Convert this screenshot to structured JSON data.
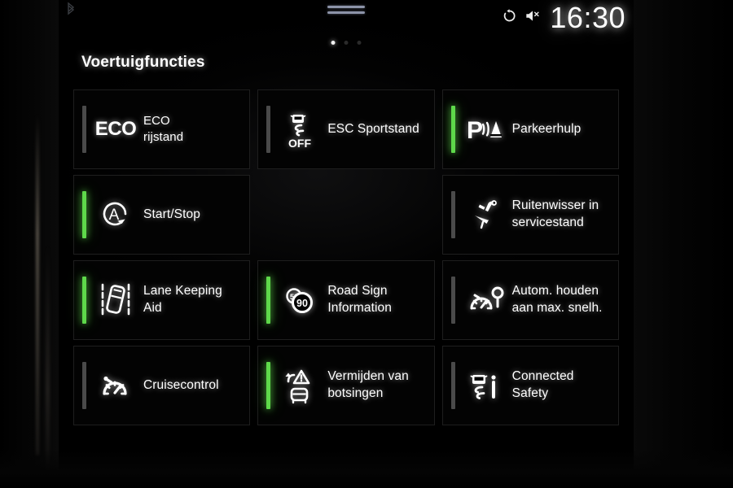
{
  "statusbar": {
    "bluetooth_icon": "bluetooth-icon",
    "drag_handle": "drag-handle",
    "alarm_icon": "alarm-timer-icon",
    "mute_icon": "volume-muted-icon",
    "time": "16:30"
  },
  "page_indicator": {
    "total": 3,
    "current": 1
  },
  "header": {
    "title": "Voertuigfuncties"
  },
  "colors": {
    "accent_active": "#5ed84a",
    "indicator_inactive": "#4a4a4a",
    "text": "#ffffff",
    "tile_border": "#1e1e1e",
    "background": "#000000"
  },
  "tiles": [
    {
      "id": "eco-rijstand",
      "icon": "eco-icon",
      "icon_text": "ECO",
      "label_line1": "ECO",
      "label_line2": "rijstand",
      "active": false
    },
    {
      "id": "esc-sportstand",
      "icon": "esc-off-icon",
      "label_line1": "ESC Sportstand",
      "label_line2": "",
      "active": false
    },
    {
      "id": "parkeerhulp",
      "icon": "park-assist-icon",
      "label_line1": "Parkeerhulp",
      "label_line2": "",
      "active": true
    },
    {
      "id": "start-stop",
      "icon": "start-stop-icon",
      "label_line1": "Start/Stop",
      "label_line2": "",
      "active": true
    },
    {
      "id": "empty-slot",
      "icon": "",
      "label_line1": "",
      "label_line2": "",
      "active": false
    },
    {
      "id": "ruitenwisser-servicestand",
      "icon": "wiper-service-icon",
      "label_line1": "Ruitenwisser in",
      "label_line2": "servicestand",
      "active": false
    },
    {
      "id": "lane-keeping-aid",
      "icon": "lane-keeping-icon",
      "label_line1": "Lane Keeping",
      "label_line2": "Aid",
      "active": true
    },
    {
      "id": "road-sign-information",
      "icon": "road-sign-icon",
      "icon_value_front": "90",
      "icon_value_back": "50",
      "label_line1": "Road Sign",
      "label_line2": "Information",
      "active": true
    },
    {
      "id": "autom-houden-max-snelh",
      "icon": "speed-limiter-pin-icon",
      "label_line1": "Autom. houden",
      "label_line2": "aan max. snelh.",
      "active": false
    },
    {
      "id": "cruisecontrol",
      "icon": "cruise-control-icon",
      "label_line1": "Cruisecontrol",
      "label_line2": "",
      "active": false
    },
    {
      "id": "vermijden-van-botsingen",
      "icon": "collision-avoidance-icon",
      "label_line1": "Vermijden van",
      "label_line2": "botsingen",
      "active": true
    },
    {
      "id": "connected-safety",
      "icon": "connected-safety-icon",
      "label_line1": "Connected",
      "label_line2": "Safety",
      "active": false
    }
  ]
}
